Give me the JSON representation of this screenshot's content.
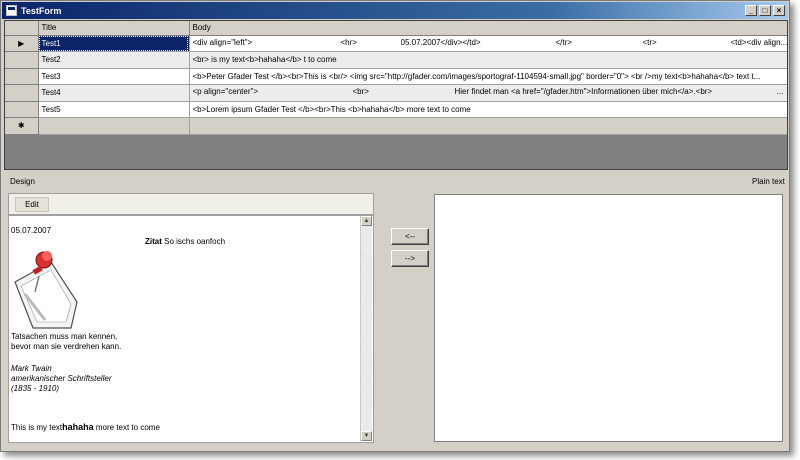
{
  "window": {
    "title": "TestForm",
    "buttons": [
      "_",
      "□",
      "×"
    ]
  },
  "grid": {
    "headers": [
      "Title",
      "Body"
    ],
    "rows": [
      {
        "indicator": "▶",
        "title": "Test1",
        "body_segments": [
          "<div align=\"left\">",
          "<hr>",
          "05.07.2007</div></td>",
          "</tr>",
          "<tr>",
          "<td><div align..."
        ]
      },
      {
        "indicator": "",
        "title": "Test2",
        "body_segments": [
          "<br> is my text<b>hahaha</b> t to come"
        ]
      },
      {
        "indicator": "",
        "title": "Test3",
        "body_segments": [
          "<b>Peter Gfader Test </b><br>This is <br/> <img src=\"http://gfader.com/images/sportograf-1104594-small.jpg\" border=\"0\"> <br />my text<b>hahaha</b> text t..."
        ]
      },
      {
        "indicator": "",
        "title": "Test4",
        "body_segments": [
          "<p align=\"center\">",
          "<br>",
          "Hier findet man <a href=\"/gfader.htm\">Informationen über mich</a>.<br>",
          "..."
        ]
      },
      {
        "indicator": "",
        "title": "Test5",
        "body_segments": [
          "<b>Lorem ipsum Gfader Test </b><br>This <b>hahaha</b> more text to come"
        ]
      }
    ],
    "new_row_indicator": "✱"
  },
  "labels": {
    "design": "Design",
    "plain_text": "Plain text"
  },
  "design_panel": {
    "edit_button": "Edit",
    "date": "05.07.2007",
    "zitat_bold": "Zitat",
    "zitat_rest": " So ischs oanfoch",
    "quote_line1": "Tatsachen muss man kennen,",
    "quote_line2": "bevor man sie verdrehen kann.",
    "author_line1": "Mark Twain",
    "author_line2": "amerikanischer Schriftsteller",
    "author_line3": "(1835 - 1910)",
    "body_prefix": "This is my text",
    "body_bold": "hahaha",
    "body_suffix": " more text to come",
    "scroll_up": "▲",
    "scroll_down": "▼"
  },
  "buttons": {
    "to_design": "<--",
    "to_plain": "-->"
  }
}
